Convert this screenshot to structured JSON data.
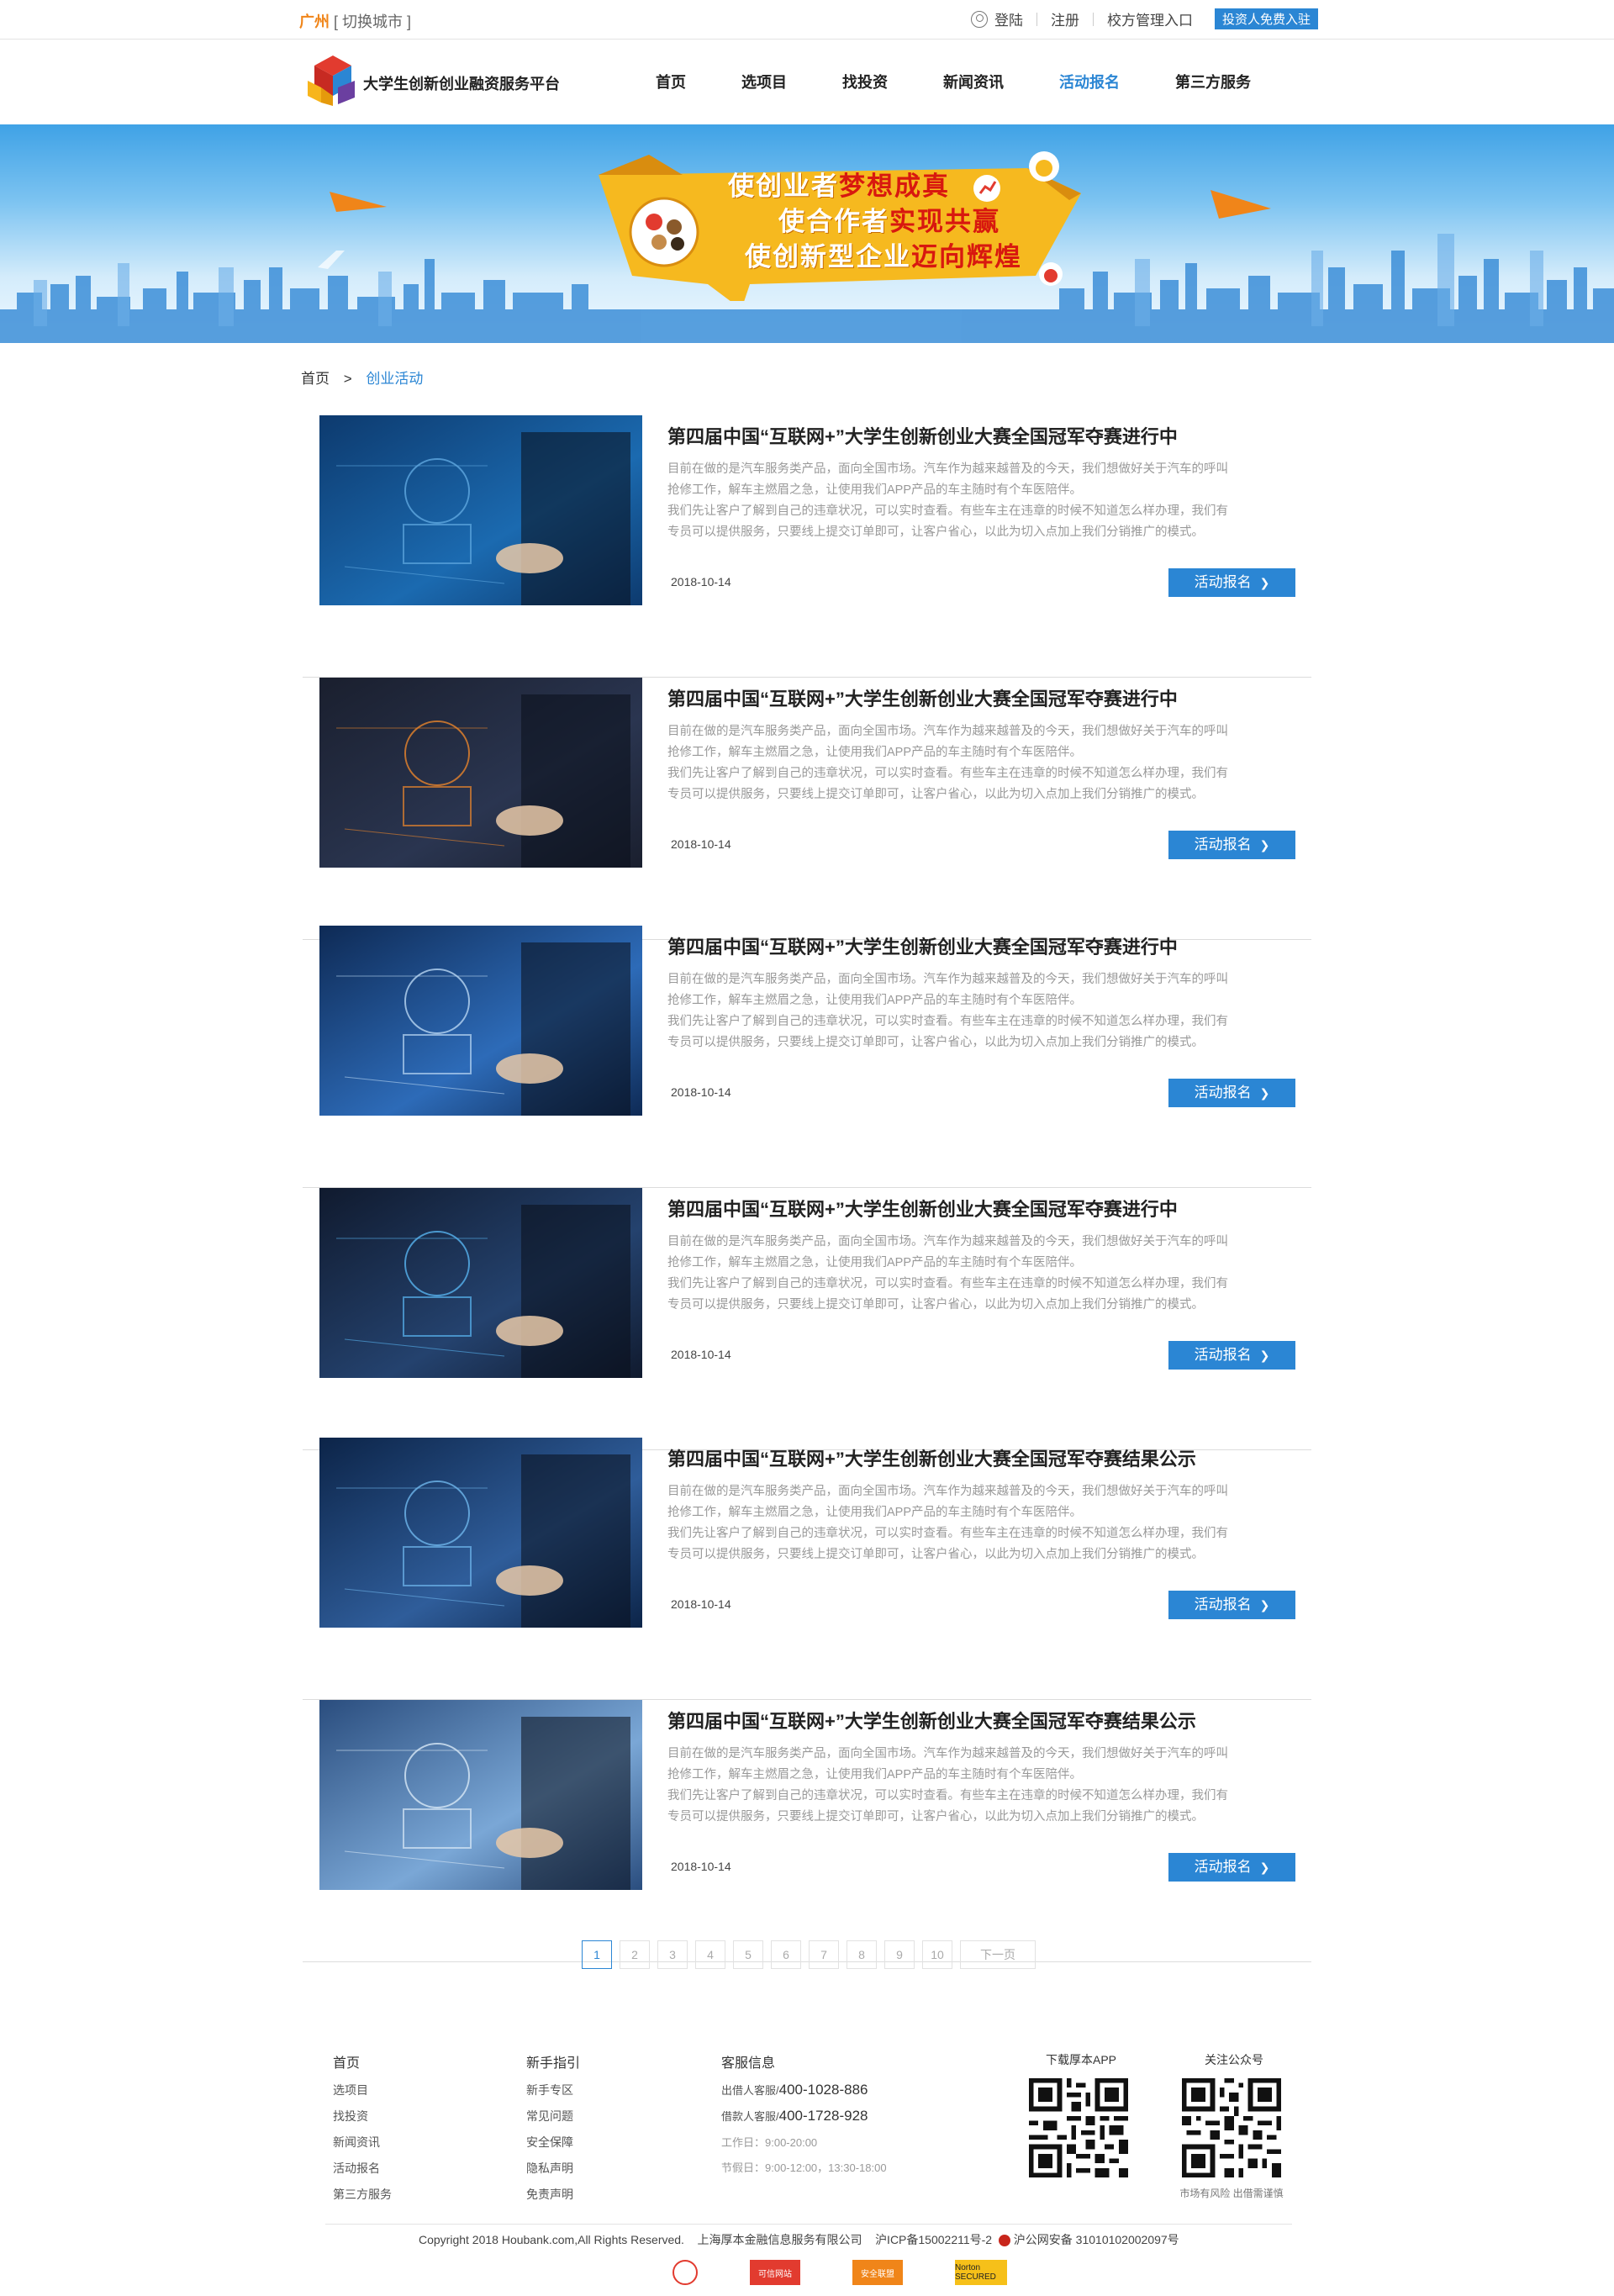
{
  "topbar": {
    "city": "广州",
    "switch_city": "[ 切换城市 ]",
    "login": "登陆",
    "register": "注册",
    "school_entry": "校方管理入口",
    "investor_entry": "投资人免费入驻"
  },
  "header": {
    "site_name": "大学生创新创业融资服务平台",
    "nav": [
      "首页",
      "选项目",
      "找投资",
      "新闻资讯",
      "活动报名",
      "第三方服务"
    ],
    "active_nav": "活动报名"
  },
  "banner": {
    "line1_a": "使创业者",
    "line1_b": "梦想成真",
    "line2_a": "使合作者",
    "line2_b": "实现共赢",
    "line3_a": "使创新型企业",
    "line3_b": "迈向辉煌"
  },
  "breadcrumb": {
    "home": "首页",
    "sep": ">",
    "current": "创业活动"
  },
  "activities": [
    {
      "title": "第四届中国“互联网+”大学生创新创业大赛全国冠军夺赛进行中",
      "line1": "目前在做的是汽车服务类产品，面向全国市场。汽车作为越来越普及的今天，我们想做好关于汽车的呼叫",
      "line2": "抢修工作，解车主燃眉之急，让使用我们APP产品的车主随时有个车医陪伴。",
      "line3": "我们先让客户了解到自己的违章状况，可以实时查看。有些车主在违章的时候不知道怎么样办理，我们有",
      "line4": "专员可以提供服务，只要线上提交订单即可，让客户省心，以此为切入点加上我们分销推广的模式。",
      "date": "2018-10-14",
      "button": "活动报名"
    },
    {
      "title": "第四届中国“互联网+”大学生创新创业大赛全国冠军夺赛进行中",
      "line1": "目前在做的是汽车服务类产品，面向全国市场。汽车作为越来越普及的今天，我们想做好关于汽车的呼叫",
      "line2": "抢修工作，解车主燃眉之急，让使用我们APP产品的车主随时有个车医陪伴。",
      "line3": "我们先让客户了解到自己的违章状况，可以实时查看。有些车主在违章的时候不知道怎么样办理，我们有",
      "line4": "专员可以提供服务，只要线上提交订单即可，让客户省心，以此为切入点加上我们分销推广的模式。",
      "date": "2018-10-14",
      "button": "活动报名"
    },
    {
      "title": "第四届中国“互联网+”大学生创新创业大赛全国冠军夺赛进行中",
      "line1": "目前在做的是汽车服务类产品，面向全国市场。汽车作为越来越普及的今天，我们想做好关于汽车的呼叫",
      "line2": "抢修工作，解车主燃眉之急，让使用我们APP产品的车主随时有个车医陪伴。",
      "line3": "我们先让客户了解到自己的违章状况，可以实时查看。有些车主在违章的时候不知道怎么样办理，我们有",
      "line4": "专员可以提供服务，只要线上提交订单即可，让客户省心，以此为切入点加上我们分销推广的模式。",
      "date": "2018-10-14",
      "button": "活动报名"
    },
    {
      "title": "第四届中国“互联网+”大学生创新创业大赛全国冠军夺赛进行中",
      "line1": "目前在做的是汽车服务类产品，面向全国市场。汽车作为越来越普及的今天，我们想做好关于汽车的呼叫",
      "line2": "抢修工作，解车主燃眉之急，让使用我们APP产品的车主随时有个车医陪伴。",
      "line3": "我们先让客户了解到自己的违章状况，可以实时查看。有些车主在违章的时候不知道怎么样办理，我们有",
      "line4": "专员可以提供服务，只要线上提交订单即可，让客户省心，以此为切入点加上我们分销推广的模式。",
      "date": "2018-10-14",
      "button": "活动报名"
    },
    {
      "title": "第四届中国“互联网+”大学生创新创业大赛全国冠军夺赛结果公示",
      "line1": "目前在做的是汽车服务类产品，面向全国市场。汽车作为越来越普及的今天，我们想做好关于汽车的呼叫",
      "line2": "抢修工作，解车主燃眉之急，让使用我们APP产品的车主随时有个车医陪伴。",
      "line3": "我们先让客户了解到自己的违章状况，可以实时查看。有些车主在违章的时候不知道怎么样办理，我们有",
      "line4": "专员可以提供服务，只要线上提交订单即可，让客户省心，以此为切入点加上我们分销推广的模式。",
      "date": "2018-10-14",
      "button": "活动报名"
    },
    {
      "title": "第四届中国“互联网+”大学生创新创业大赛全国冠军夺赛结果公示",
      "line1": "目前在做的是汽车服务类产品，面向全国市场。汽车作为越来越普及的今天，我们想做好关于汽车的呼叫",
      "line2": "抢修工作，解车主燃眉之急，让使用我们APP产品的车主随时有个车医陪伴。",
      "line3": "我们先让客户了解到自己的违章状况，可以实时查看。有些车主在违章的时候不知道怎么样办理，我们有",
      "line4": "专员可以提供服务，只要线上提交订单即可，让客户省心，以此为切入点加上我们分销推广的模式。",
      "date": "2018-10-14",
      "button": "活动报名"
    }
  ],
  "thumb_icons": [
    "email-tablet-icon",
    "growth-chart-icon",
    "keyboard-hands-icon",
    "globe-network-icon",
    "business-strategy-icon",
    "credit-card-keyboard-icon"
  ],
  "pagination": {
    "pages": [
      "1",
      "2",
      "3",
      "4",
      "5",
      "6",
      "7",
      "8",
      "9",
      "10"
    ],
    "current": "1",
    "next": "下一页"
  },
  "footer": {
    "col1": {
      "title": "首页",
      "links": [
        "选项目",
        "找投资",
        "新闻资讯",
        "活动报名",
        "第三方服务"
      ]
    },
    "col2": {
      "title": "新手指引",
      "links": [
        "新手专区",
        "常见问题",
        "安全保障",
        "隐私声明",
        "免责声明"
      ]
    },
    "service": {
      "title": "客服信息",
      "lender_label": "出借人客服/",
      "lender_phone": "400-1028-886",
      "borrower_label": "借款人客服/",
      "borrower_phone": "400-1728-928",
      "workday": "工作日：9:00-20:00",
      "holiday": "节假日：9:00-12:00，13:30-18:00"
    },
    "app_qr_caption": "下载厚本APP",
    "wechat_qr_caption": "关注公众号",
    "risk_note": "市场有风险 出借需谨慎",
    "copyright": "Copyright 2018 Houbank.com,All Rights Reserved.",
    "company": "上海厚本金融信息服务有限公司",
    "icp": "沪ICP备15002211号-2",
    "police": "沪公网安备 31010102002097号",
    "badges": [
      "可信网站",
      "安全联盟",
      "Norton SECURED"
    ]
  },
  "colors": {
    "accent": "#2b86d4",
    "city": "#f08519",
    "banner_ribbon": "#f6b91f"
  }
}
